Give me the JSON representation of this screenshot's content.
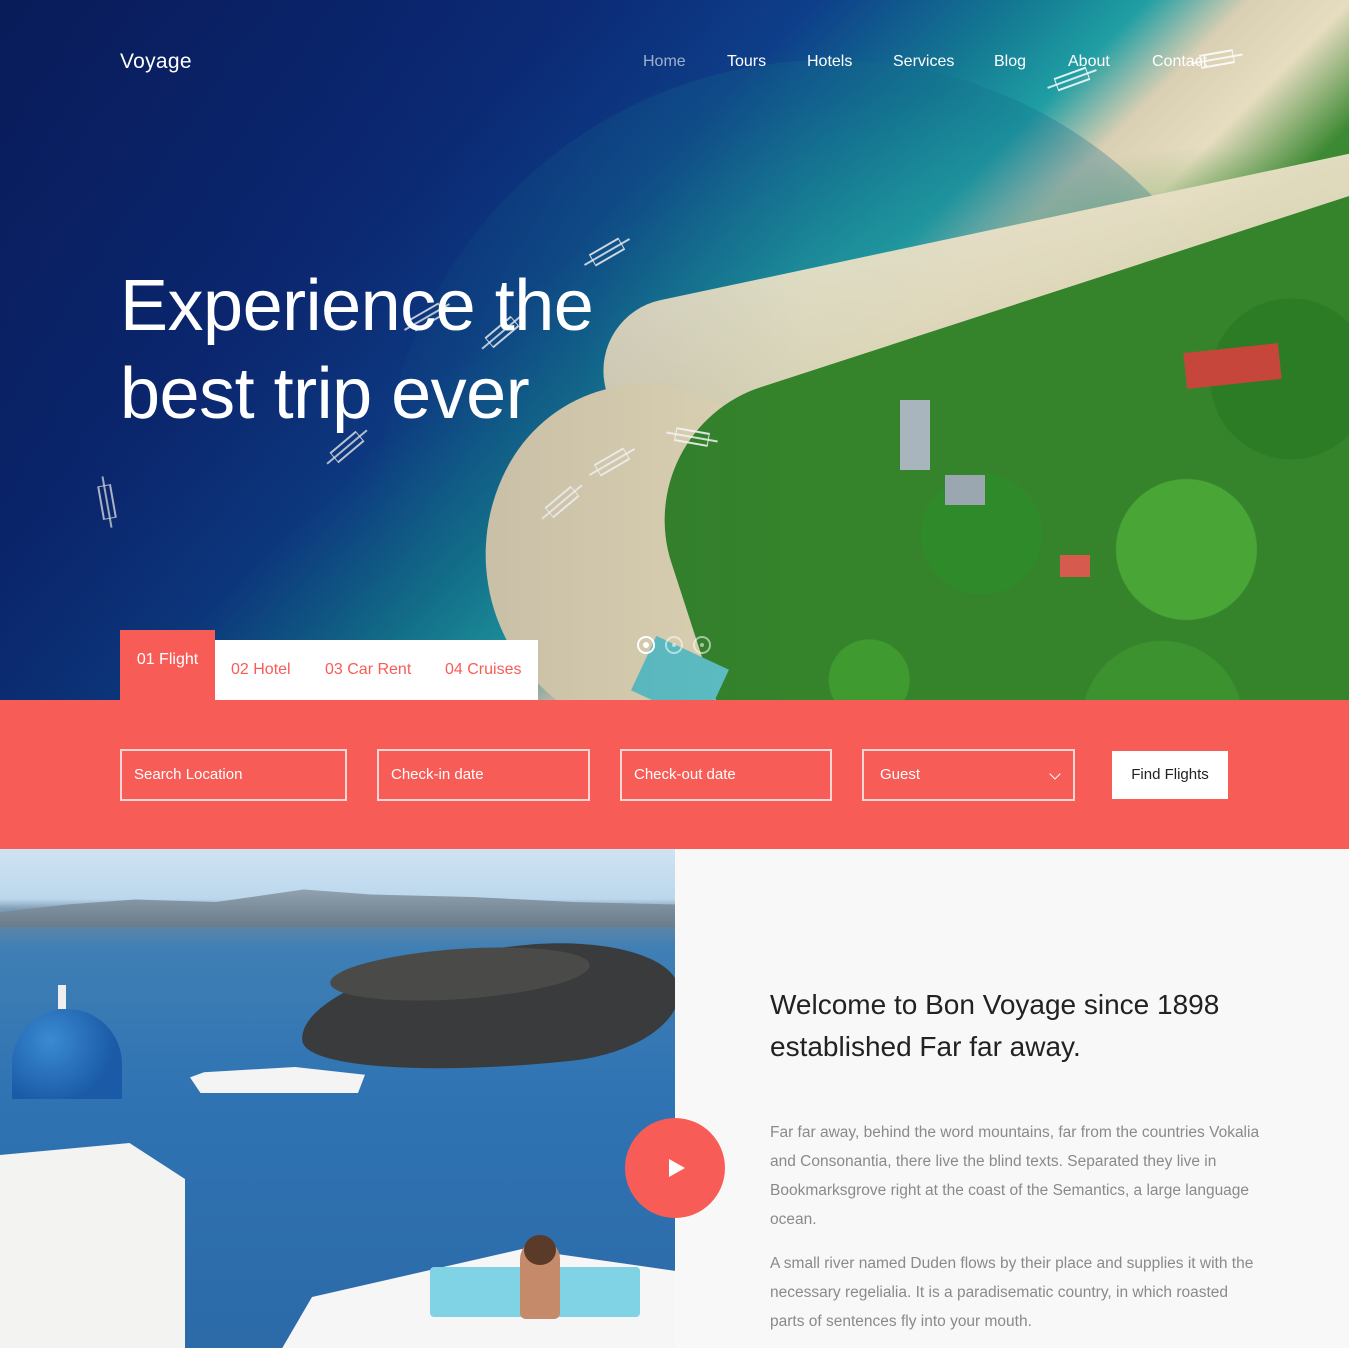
{
  "brand": "Voyage",
  "nav": {
    "items": [
      {
        "label": "Home",
        "active": true
      },
      {
        "label": "Tours",
        "active": false
      },
      {
        "label": "Hotels",
        "active": false
      },
      {
        "label": "Services",
        "active": false
      },
      {
        "label": "Blog",
        "active": false
      },
      {
        "label": "About",
        "active": false
      },
      {
        "label": "Contact",
        "active": false
      }
    ]
  },
  "hero": {
    "title": "Experience the best trip ever",
    "slides": 3,
    "active_slide": 1
  },
  "tabs": [
    {
      "label": "01 Flight",
      "active": true
    },
    {
      "label": "02 Hotel",
      "active": false
    },
    {
      "label": "03 Car Rent",
      "active": false
    },
    {
      "label": "04 Cruises",
      "active": false
    }
  ],
  "search": {
    "location_placeholder": "Search Location",
    "checkin_placeholder": "Check-in date",
    "checkout_placeholder": "Check-out date",
    "guest_label": "Guest",
    "submit_label": "Find Flights"
  },
  "about": {
    "heading": "Welcome to Bon Voyage since 1898 established Far far away.",
    "paragraph1": "Far far away, behind the word mountains, far from the countries Vokalia and Consonantia, there live the blind texts. Separated they live in Bookmarksgrove right at the coast of the Semantics, a large language ocean.",
    "paragraph2": "A small river named Duden flows by their place and supplies it with the necessary regelialia. It is a paradisematic country, in which roasted parts of sentences fly into your mouth.",
    "play_icon": "play-icon"
  },
  "colors": {
    "accent": "#f85c56",
    "text_dark": "#222222",
    "text_muted": "#8a8a8a",
    "section_bg": "#f8f8f8"
  }
}
